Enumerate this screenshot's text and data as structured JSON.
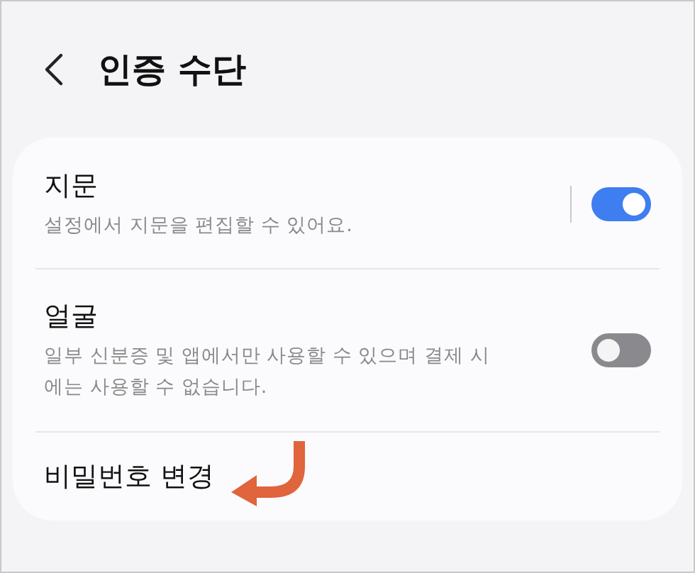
{
  "header": {
    "title": "인증 수단"
  },
  "items": [
    {
      "kind": "toggle",
      "title": "지문",
      "subtitle": "설정에서 지문을 편집할 수 있어요.",
      "on": true,
      "split": true
    },
    {
      "kind": "toggle",
      "title": "얼굴",
      "subtitle": "일부 신분증 및 앱에서만 사용할 수 있으며 결제 시에는 사용할 수 없습니다.",
      "on": false,
      "split": false
    },
    {
      "kind": "link",
      "title": "비밀번호 변경",
      "pointer": true
    }
  ]
}
